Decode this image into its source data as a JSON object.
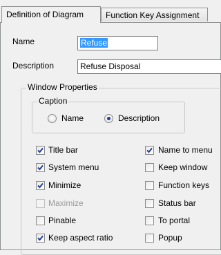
{
  "tabs": [
    {
      "label": "Definition of Diagram",
      "active": true
    },
    {
      "label": "Function Key Assignment",
      "active": false
    }
  ],
  "fields": {
    "name_label": "Name",
    "name_value": "Refuse",
    "description_label": "Description",
    "description_value": "Refuse Disposal"
  },
  "window_properties": {
    "title": "Window Properties",
    "caption": {
      "title": "Caption",
      "options": [
        {
          "label": "Name",
          "selected": false
        },
        {
          "label": "Description",
          "selected": true
        }
      ]
    },
    "left_checkboxes": [
      {
        "label": "Title bar",
        "checked": true,
        "enabled": true
      },
      {
        "label": "System menu",
        "checked": true,
        "enabled": true
      },
      {
        "label": "Minimize",
        "checked": true,
        "enabled": true
      },
      {
        "label": "Maximize",
        "checked": false,
        "enabled": false
      },
      {
        "label": "Pinable",
        "checked": false,
        "enabled": true
      },
      {
        "label": "Keep aspect ratio",
        "checked": true,
        "enabled": true
      }
    ],
    "right_checkboxes": [
      {
        "label": "Name to menu",
        "checked": true,
        "enabled": true
      },
      {
        "label": "Keep window",
        "checked": false,
        "enabled": true
      },
      {
        "label": "Function keys",
        "checked": false,
        "enabled": true
      },
      {
        "label": "Status bar",
        "checked": false,
        "enabled": true
      },
      {
        "label": "To portal",
        "checked": false,
        "enabled": true
      },
      {
        "label": "Popup",
        "checked": false,
        "enabled": true
      }
    ]
  }
}
